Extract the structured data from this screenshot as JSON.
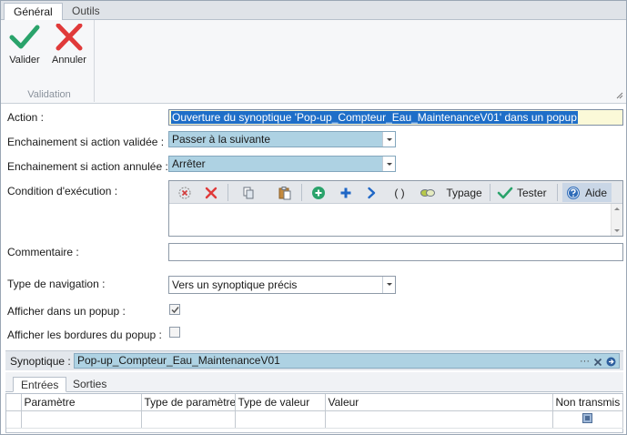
{
  "ribbon": {
    "tabs": [
      {
        "label": "Général",
        "active": true
      },
      {
        "label": "Outils",
        "active": false
      }
    ],
    "group": {
      "label": "Validation",
      "buttons": [
        {
          "label": "Valider",
          "icon": "checkmark-icon",
          "color": "#2aa36b"
        },
        {
          "label": "Annuler",
          "icon": "cross-icon",
          "color": "#e03a3a"
        }
      ]
    }
  },
  "form": {
    "action": {
      "label": "Action :",
      "value": "Ouverture du synoptique 'Pop-up_Compteur_Eau_MaintenanceV01' dans un popup"
    },
    "on_valid": {
      "label": "Enchainement si action validée :",
      "value": "Passer à la suivante"
    },
    "on_cancel": {
      "label": "Enchainement si action annulée :",
      "value": "Arrêter"
    },
    "condition": {
      "label": "Condition d'exécution :",
      "toolbar": {
        "typage": "Typage",
        "tester": "Tester",
        "aide": "Aide",
        "parens": "( )"
      }
    },
    "comment": {
      "label": "Commentaire :",
      "value": ""
    },
    "nav_type": {
      "label": "Type de navigation :",
      "value": "Vers un synoptique précis"
    },
    "show_popup": {
      "label": "Afficher dans un popup :",
      "checked": true
    },
    "show_borders": {
      "label": "Afficher les bordures du popup :",
      "checked": false
    }
  },
  "synoptique": {
    "label": "Synoptique :",
    "value": "Pop-up_Compteur_Eau_MaintenanceV01",
    "dots": "···"
  },
  "subtabs": [
    {
      "label": "Entrées",
      "active": true
    },
    {
      "label": "Sorties",
      "active": false
    }
  ],
  "grid": {
    "columns": [
      "Paramètre",
      "Type de paramètre",
      "Type de valeur",
      "Valeur",
      "Non transmis"
    ],
    "rows": [
      {
        "parametre": "",
        "type_param": "",
        "type_valeur": "",
        "valeur": "",
        "non_transmis": true
      }
    ]
  }
}
